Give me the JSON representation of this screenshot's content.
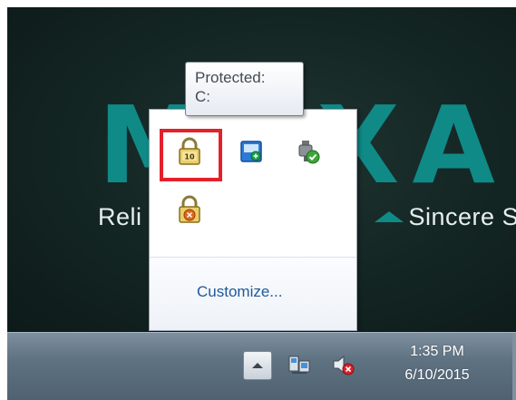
{
  "desktop": {
    "logo_text": "MOXA",
    "tagline_left": "Reli",
    "tagline_right": "Sincere S"
  },
  "tooltip": {
    "line1": "Protected:",
    "line2": "C:"
  },
  "flyout": {
    "icons": [
      {
        "name": "bitlocker-protected-drive-icon",
        "badge": "10"
      },
      {
        "name": "network-app-icon",
        "badge": ""
      },
      {
        "name": "usb-device-ok-icon",
        "badge": ""
      },
      {
        "name": "bitlocker-warning-icon",
        "badge": ""
      }
    ],
    "customize_label": "Customize..."
  },
  "taskbar": {
    "time": "1:35 PM",
    "date": "6/10/2015",
    "icons": [
      "network-icon",
      "volume-muted-icon"
    ]
  },
  "colors": {
    "moxa_teal": "#0f8a87",
    "highlight_red": "#e3212b",
    "link_blue": "#1e5a9c"
  }
}
